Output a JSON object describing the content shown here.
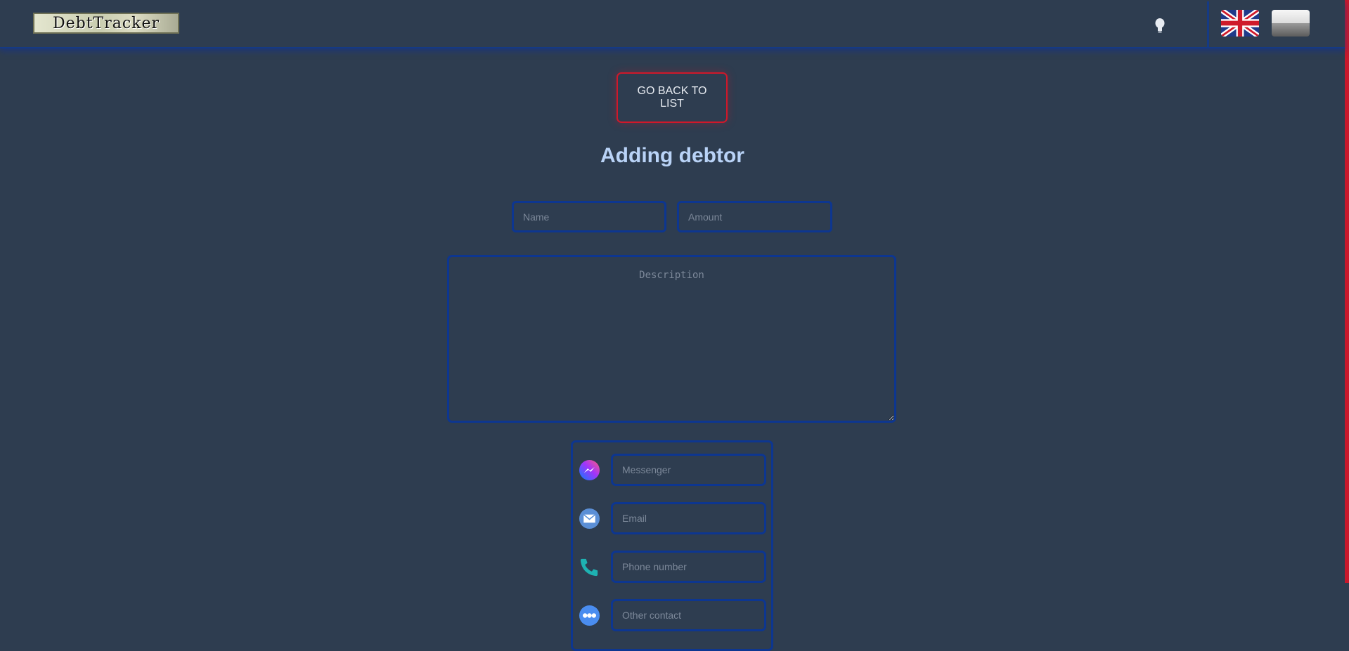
{
  "navbar": {
    "logo_text": "DebtTracker",
    "theme_toggle_icon": "lightbulb-icon",
    "languages": [
      {
        "code": "en",
        "icon": "uk-flag-icon"
      },
      {
        "code": "pl",
        "icon": "poland-flag-icon"
      }
    ]
  },
  "main": {
    "back_button_label": "GO BACK TO LIST",
    "title": "Adding debtor",
    "name_placeholder": "Name",
    "amount_placeholder": "Amount",
    "description_placeholder": "Description"
  },
  "contacts": [
    {
      "icon": "messenger-icon",
      "placeholder": "Messenger"
    },
    {
      "icon": "email-icon",
      "placeholder": "Email"
    },
    {
      "icon": "phone-icon",
      "placeholder": "Phone number"
    },
    {
      "icon": "more-icon",
      "placeholder": "Other contact"
    }
  ],
  "colors": {
    "background": "#2e3d50",
    "border_blue": "#0d3690",
    "accent_red": "#d0182a",
    "title": "#b9d3f7"
  }
}
